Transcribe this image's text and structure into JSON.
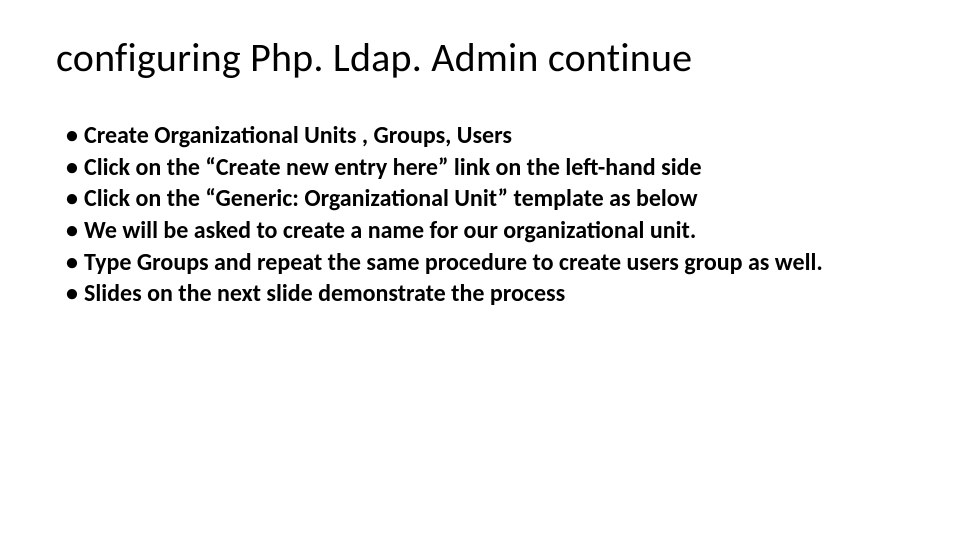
{
  "title": "configuring Php. Ldap. Admin continue",
  "bullets": [
    "Create Organizational Units , Groups, Users",
    "Click on the “Create new entry here” link on the left-hand side",
    "Click on the “Generic: Organizational Unit” template as below",
    "We will be asked to create a name for our organizational unit.",
    "Type Groups and repeat the same procedure to create users group as well.",
    "Slides on the next slide demonstrate the process"
  ]
}
